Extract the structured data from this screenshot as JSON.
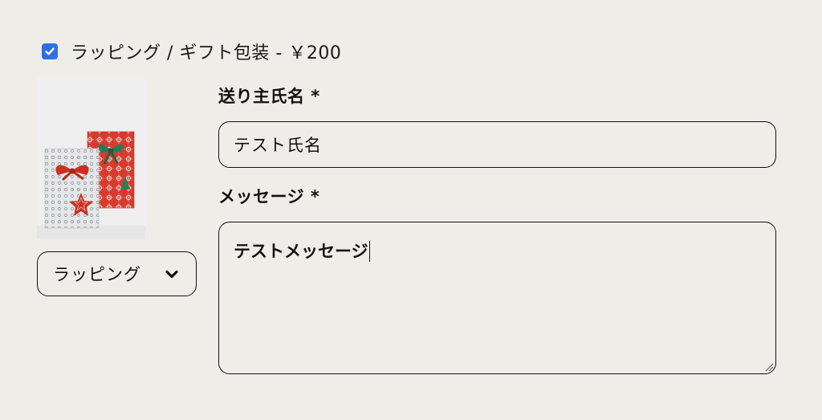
{
  "wrapping_option": {
    "checked": true,
    "label": "ラッピング / ギフト包装 - ￥200"
  },
  "wrapping_select": {
    "selected": "ラッピング"
  },
  "sender": {
    "label": "送り主氏名 *",
    "value": "テスト氏名"
  },
  "message": {
    "label": "メッセージ *",
    "value": "テストメッセージ"
  },
  "colors": {
    "accent": "#2f6fe4",
    "background": "#efede8",
    "border": "#111111"
  },
  "icons": {
    "checkbox": "check-icon",
    "select": "chevron-down-icon"
  }
}
